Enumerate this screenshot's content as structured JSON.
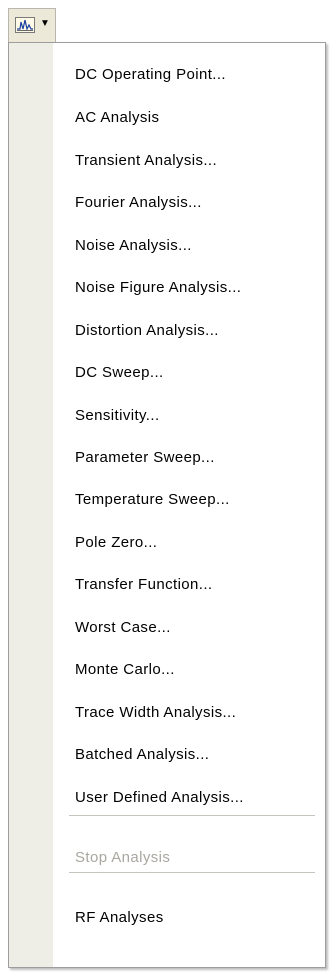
{
  "toolbar": {
    "button_icon": "analysis-waveform-icon",
    "dropdown_icon": "dropdown-arrow-icon"
  },
  "menu": {
    "items": [
      {
        "label": "DC Operating Point..."
      },
      {
        "label": "AC Analysis"
      },
      {
        "label": "Transient Analysis..."
      },
      {
        "label": "Fourier Analysis..."
      },
      {
        "label": "Noise Analysis..."
      },
      {
        "label": "Noise Figure Analysis..."
      },
      {
        "label": "Distortion Analysis..."
      },
      {
        "label": "DC Sweep..."
      },
      {
        "label": "Sensitivity..."
      },
      {
        "label": "Parameter Sweep..."
      },
      {
        "label": "Temperature Sweep..."
      },
      {
        "label": "Pole Zero..."
      },
      {
        "label": "Transfer Function..."
      },
      {
        "label": "Worst Case..."
      },
      {
        "label": "Monte Carlo..."
      },
      {
        "label": "Trace Width Analysis..."
      },
      {
        "label": "Batched Analysis..."
      },
      {
        "label": "User Defined Analysis..."
      },
      {
        "label": "Stop Analysis",
        "disabled": true
      },
      {
        "label": "RF Analyses"
      }
    ]
  }
}
